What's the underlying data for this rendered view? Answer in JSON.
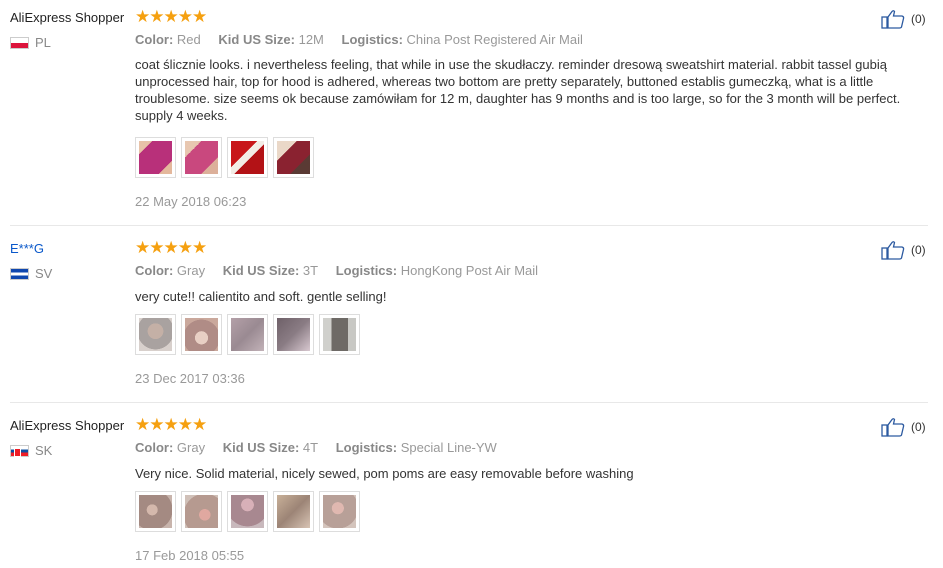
{
  "reviews": [
    {
      "user": "AliExpress Shopper",
      "country": "PL",
      "stars": "★★★★★",
      "color_label": "Color:",
      "color": "Red",
      "size_label": "Kid US Size:",
      "size": "12M",
      "logistics_label": "Logistics:",
      "logistics": "China Post Registered Air Mail",
      "text": "coat ślicznie looks. i nevertheless feeling, that while in use the skudłaczy. reminder dresową sweatshirt material. rabbit tassel gubią unprocessed hair, top for hood is adhered, whereas two bottom are pretty separately, buttoned establis gumeczką, what is a little troublesome. size seems ok because zamówiłam for 12 m, daughter has 9 months and is too large, so for the 3 month will be perfect. supply 4 weeks.",
      "photos": [
        "#b8307a",
        "#c9487e",
        "#c8161a",
        "#8a2230"
      ],
      "date": "22 May 2018 06:23",
      "likes": "(0)"
    },
    {
      "user": "E***G",
      "country": "SV",
      "stars": "★★★★★",
      "color_label": "Color:",
      "color": "Gray",
      "size_label": "Kid US Size:",
      "size": "3T",
      "logistics_label": "Logistics:",
      "logistics": "HongKong Post Air Mail",
      "text": "very cute!! calientito and soft. gentle selling!",
      "photos": [
        "#a9a2a0",
        "#b08c86",
        "#9a8a92",
        "#8a7c84",
        "#6e6a66"
      ],
      "date": "23 Dec 2017 03:36",
      "likes": "(0)"
    },
    {
      "user": "AliExpress Shopper",
      "country": "SK",
      "stars": "★★★★★",
      "color_label": "Color:",
      "color": "Gray",
      "size_label": "Kid US Size:",
      "size": "4T",
      "logistics_label": "Logistics:",
      "logistics": "Special Line-YW",
      "text": "Very nice. Solid material, nicely sewed, pom poms are easy removable before washing",
      "photos": [
        "#a48a82",
        "#b69a90",
        "#a88890",
        "#9c8476",
        "#b8a098"
      ],
      "date": "17 Feb 2018 05:55",
      "likes": "(0)"
    }
  ],
  "icons": {
    "like": "thumbs-up-icon",
    "star": "star-icon"
  },
  "colors": {
    "stars": "#f5a010",
    "link": "#0a58ca",
    "muted": "#999999"
  }
}
